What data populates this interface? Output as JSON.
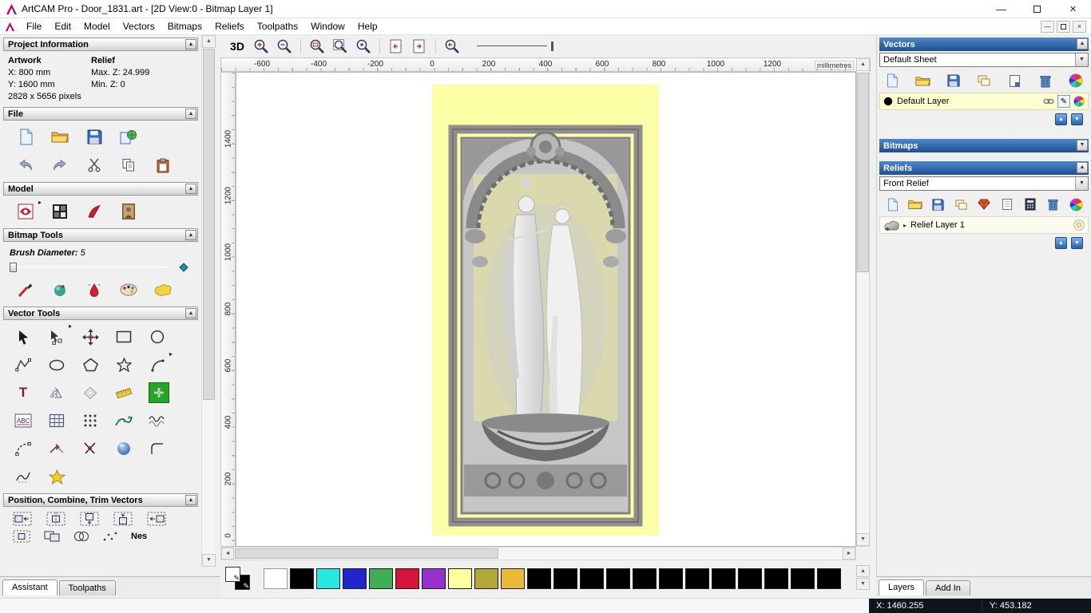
{
  "window": {
    "title": "ArtCAM Pro - Door_1831.art - [2D View:0 - Bitmap Layer 1]"
  },
  "menu": {
    "items": [
      "File",
      "Edit",
      "Model",
      "Vectors",
      "Bitmaps",
      "Reliefs",
      "Toolpaths",
      "Window",
      "Help"
    ]
  },
  "icons": {
    "collapse": "▲",
    "expand": "▼",
    "combo": "▼",
    "up": "▲",
    "down": "▼",
    "left": "◄",
    "right": "►",
    "caret": "▸",
    "pen": "✎",
    "win_min": "—",
    "win_close": "×",
    "text_tool": "T",
    "text_block": "ABC"
  },
  "left_panel": {
    "project_info": {
      "title": "Project Information",
      "artwork_label": "Artwork",
      "relief_label": "Relief",
      "x_value": "X: 800 mm",
      "y_value": "Y: 1600 mm",
      "pixels": "2828 x 5656 pixels",
      "max_z": "Max. Z: 24.999",
      "min_z": "Min. Z: 0"
    },
    "file_title": "File",
    "model_title": "Model",
    "bitmap_tools_title": "Bitmap Tools",
    "vector_tools_title": "Vector Tools",
    "position_title": "Position, Combine, Trim Vectors",
    "brush_label": "Brush Diameter:",
    "brush_value": "5",
    "nesting_label": "Nes",
    "tabs": {
      "assistant": "Assistant",
      "toolpaths": "Toolpaths"
    }
  },
  "canvas": {
    "view3d_label": "3D",
    "h_ticks": [
      "-600",
      "-400",
      "-200",
      "0",
      "200",
      "400",
      "600",
      "800",
      "1000",
      "1200"
    ],
    "v_ticks": [
      "1400",
      "1200",
      "1000",
      "800",
      "600",
      "400",
      "200",
      "0"
    ],
    "units": "millimetres"
  },
  "palette": {
    "colors": [
      "#ffffff",
      "#000000",
      "#25e8e0",
      "#2026cc",
      "#3fae55",
      "#d41438",
      "#9a2fd0",
      "#ffffa0",
      "#b4a83c",
      "#e8b93a",
      "#000000",
      "#000000",
      "#000000",
      "#000000",
      "#000000",
      "#000000",
      "#000000",
      "#000000",
      "#000000",
      "#000000",
      "#000000",
      "#000000"
    ]
  },
  "right_panel": {
    "vectors_title": "Vectors",
    "sheet_value": "Default Sheet",
    "vector_layer": "Default Layer",
    "bitmaps_title": "Bitmaps",
    "reliefs_title": "Reliefs",
    "relief_value": "Front Relief",
    "relief_layer": "Relief Layer 1",
    "tabs": {
      "layers": "Layers",
      "addin": "Add In"
    }
  },
  "status": {
    "x": "X: 1460.255",
    "y": "Y: 453.182"
  }
}
